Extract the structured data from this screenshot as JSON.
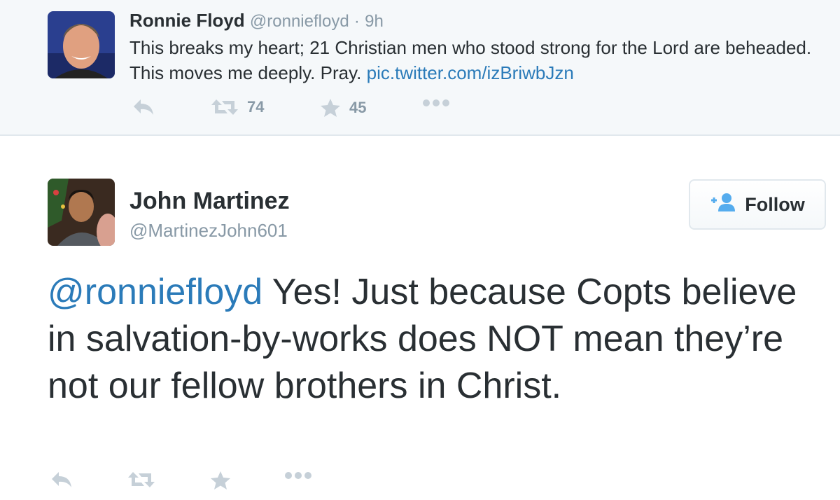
{
  "parent_tweet": {
    "author_name": "Ronnie Floyd",
    "author_handle": "@ronniefloyd",
    "separator": "·",
    "time": "9h",
    "text_before_link": "This breaks my heart; 21 Christian men who stood strong for the Lord are beheaded. This moves me deeply. Pray. ",
    "link": "pic.twitter.com/izBriwbJzn",
    "retweet_count": "74",
    "favorite_count": "45",
    "icons": [
      "reply-icon",
      "retweet-icon",
      "favorite-star-icon",
      "more-dots-icon"
    ]
  },
  "main_tweet": {
    "author_name": "John Martinez",
    "author_handle": "@MartinezJohn601",
    "follow_label": "Follow",
    "mention": "@ronniefloyd",
    "text_after_mention": " Yes! Just because Copts believe in salvation-by-works does NOT mean they’re not our fellow brothers in Christ.",
    "icons": [
      "reply-icon",
      "retweet-icon",
      "favorite-star-icon",
      "more-dots-icon"
    ]
  },
  "colors": {
    "link": "#2b7bb9",
    "muted": "#8899a6",
    "text": "#292f33",
    "parent_background": "#f5f8fa",
    "follow_icon": "#55acee"
  }
}
